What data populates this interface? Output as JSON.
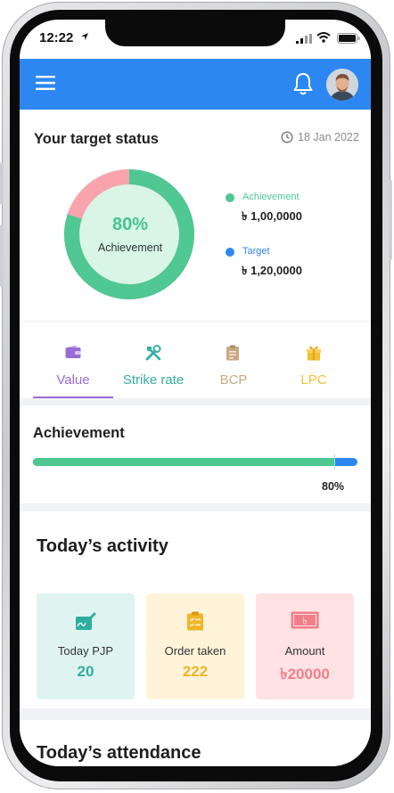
{
  "status_bar": {
    "time": "12:22"
  },
  "target": {
    "title": "Your target status",
    "date": "18 Jan 2022",
    "achievement_percent": 80,
    "percent_label": "80%",
    "center_label": "Achievement",
    "legend": [
      {
        "name": "Achievement",
        "value": "৳ 1,00,0000",
        "color": "#4fc894"
      },
      {
        "name": "Target",
        "value": "৳ 1,20,0000",
        "color": "#2d87f2"
      }
    ],
    "colors": {
      "achieved": "#4fc894",
      "remaining": "#f9a3ad",
      "inner": "#d8f5e6"
    }
  },
  "tabs": [
    {
      "label": "Value",
      "icon": "wallet-icon",
      "color": "#9b6bd6"
    },
    {
      "label": "Strike rate",
      "icon": "tools-icon",
      "color": "#35b0a3"
    },
    {
      "label": "BCP",
      "icon": "clipboard-icon",
      "color": "#c9a981"
    },
    {
      "label": "LPC",
      "icon": "gift-box-icon",
      "color": "#f2c02f"
    }
  ],
  "active_tab": "Value",
  "achievement": {
    "title": "Achievement",
    "progress": 0.8,
    "percent_label": "80%",
    "colors": {
      "fill": "#4cc890",
      "track": "#2d87f2"
    }
  },
  "activity": {
    "title": "Today’s activity",
    "tiles": [
      {
        "label": "Today PJP",
        "value": "20",
        "icon": "pjp-signature-icon",
        "bg": "#dff4f0",
        "color": "#2fae9f"
      },
      {
        "label": "Order taken",
        "value": "222",
        "icon": "order-clipboard-icon",
        "bg": "#fff4da",
        "color": "#f0b528"
      },
      {
        "label": "Amount",
        "value": "৳20000",
        "icon": "cash-note-icon",
        "bg": "#ffe2e4",
        "color": "#f07f8a"
      }
    ]
  },
  "attendance": {
    "title": "Today’s attendance"
  }
}
